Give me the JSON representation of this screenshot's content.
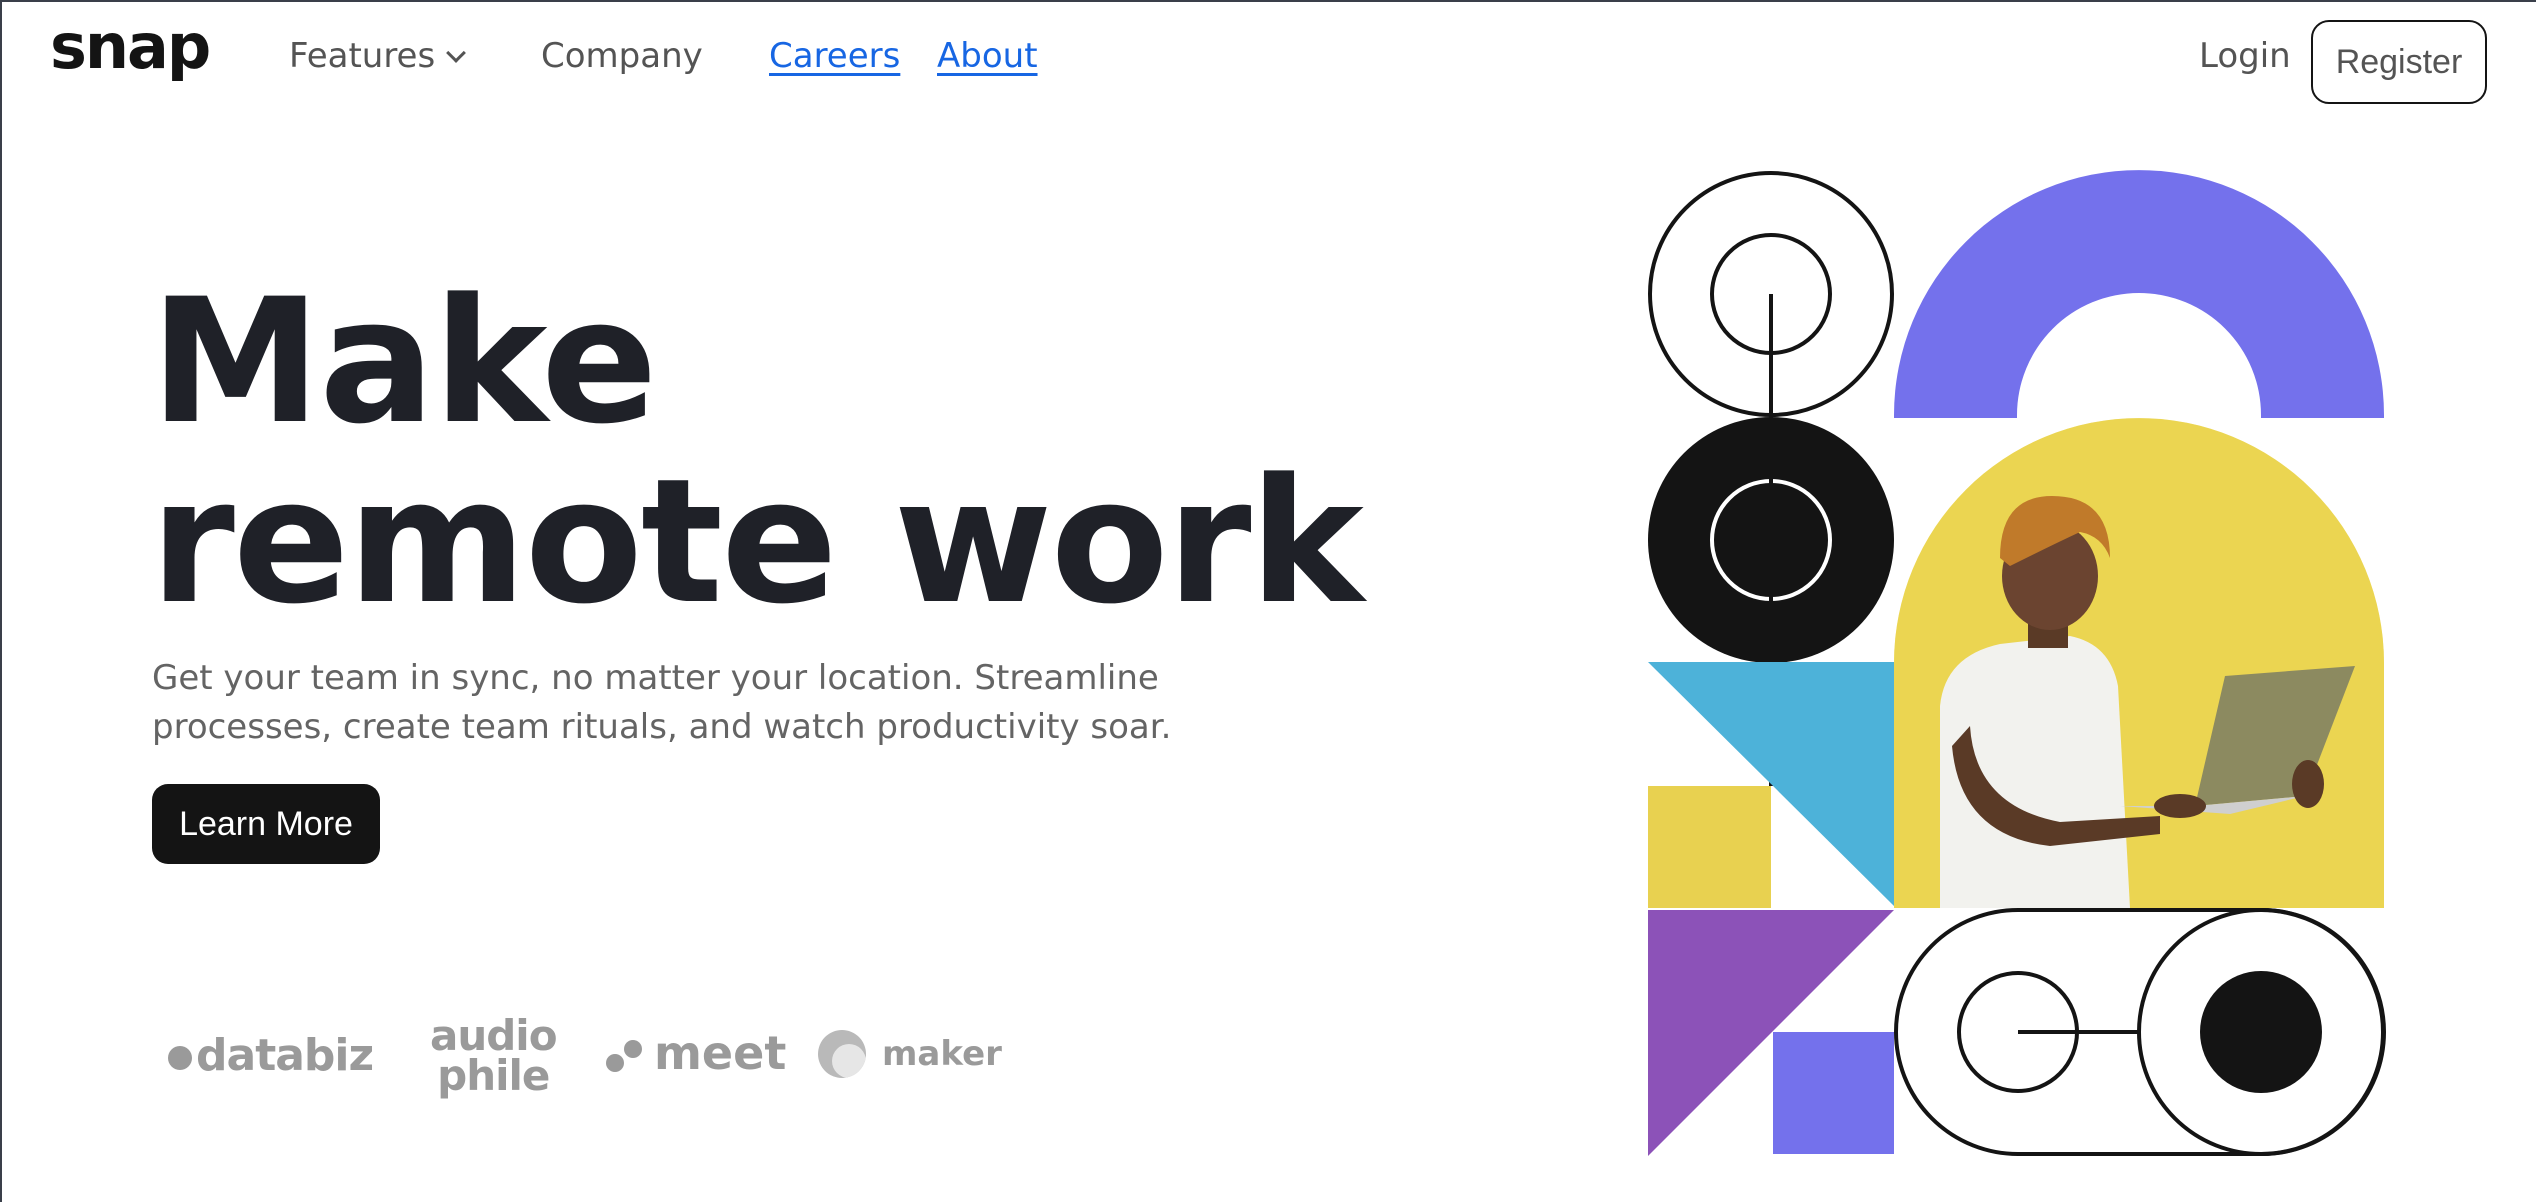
{
  "brand": {
    "logo": "snap"
  },
  "nav": {
    "features": "Features",
    "company": "Company",
    "careers": "Careers",
    "about": "About"
  },
  "auth": {
    "login": "Login",
    "register": "Register"
  },
  "hero": {
    "headline_line1": "Make",
    "headline_line2": "remote work",
    "sub_line1": "Get your team in sync, no matter your location. Streamline",
    "sub_line2": "processes, create team rituals, and watch productivity soar.",
    "cta": "Learn More"
  },
  "clients": {
    "databiz": "databiz",
    "audiophile_line1": "audio",
    "audiophile_line2": "phile",
    "meet": "meet",
    "maker": "maker"
  },
  "colors": {
    "accent_purple": "#7471ec",
    "yellow": "#e8d150",
    "blue": "#4db2d9",
    "violet": "#8c52b8",
    "dark": "#141414",
    "link": "#1766e3"
  },
  "icons": [
    "chevron-down-icon",
    "databiz-logo",
    "audiophile-logo",
    "meet-logo",
    "maker-logo"
  ]
}
